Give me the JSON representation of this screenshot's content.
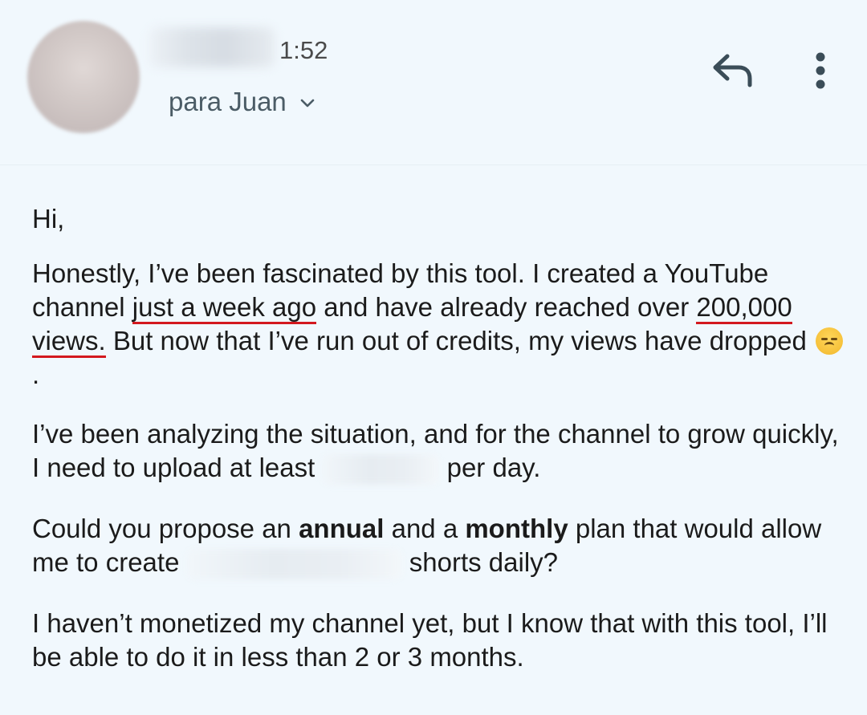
{
  "header": {
    "time": "1:52",
    "recipient_label": "para Juan",
    "icons": {
      "reply": "reply-icon",
      "more": "more-vert-icon",
      "chevron": "chevron-down-icon"
    }
  },
  "email": {
    "greeting": "Hi,",
    "p1": {
      "a": "Honestly, I’ve been fascinated by this tool. I created a YouTube channel ",
      "u1": "just a week ago",
      "b": " and have already reached over ",
      "u2": "200,000 views.",
      "c": " But now that I’ve run out of credits, my views have dropped ",
      "d": "."
    },
    "p2": {
      "a": "I’ve been analyzing the situation, and for the channel to grow quickly, I need to upload at least ",
      "b": " per day."
    },
    "p3": {
      "a": "Could you propose an ",
      "bold1": "annual",
      "b": " and a ",
      "bold2": "monthly",
      "c": " plan that would allow me to create ",
      "d": " shorts daily?"
    },
    "p4": "I haven’t monetized my channel yet, but I know that with this tool, I’ll be able to do it in less than 2 or 3 months."
  },
  "colors": {
    "background": "#f1f8fd",
    "underline": "#d3191f",
    "text": "#1b1b1b"
  }
}
